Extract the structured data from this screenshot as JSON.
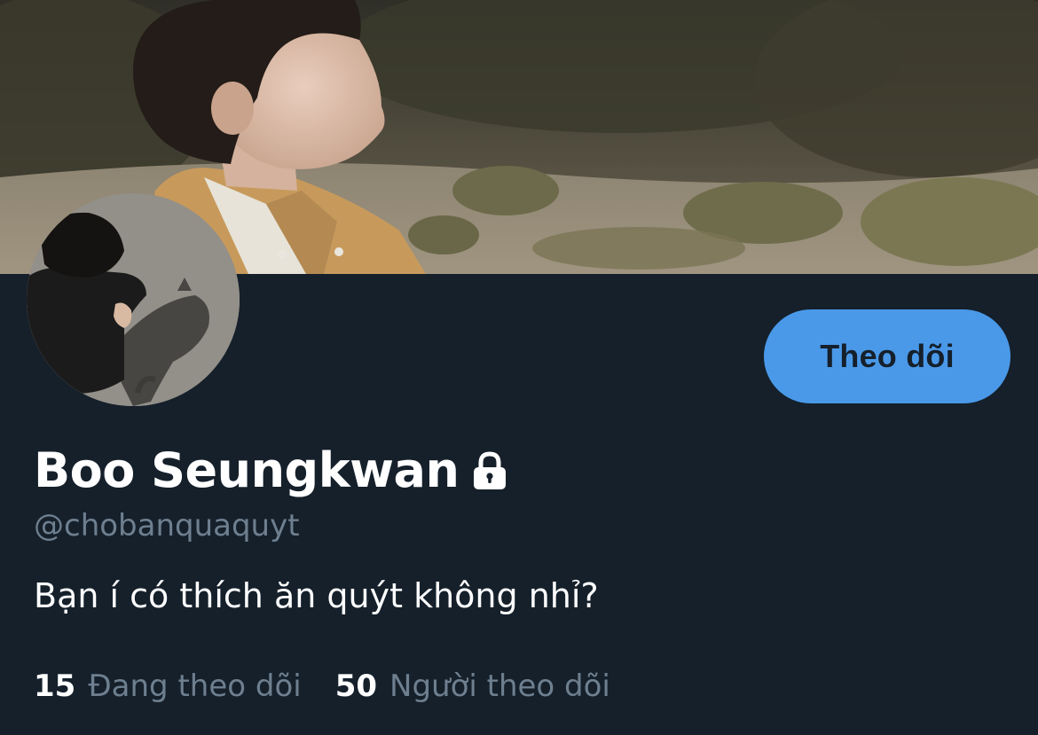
{
  "profile": {
    "banner_image": "banner-photo",
    "avatar_image": "avatar-photo",
    "display_name": "Boo Seungkwan",
    "protected_icon": "lock-icon",
    "handle": "@chobanquaquyt",
    "bio": "Bạn í có thích ăn quýt không nhỉ?"
  },
  "actions": {
    "follow_label": "Theo dõi"
  },
  "stats": {
    "following_count": "15",
    "following_label": "Đang theo dõi",
    "followers_count": "50",
    "followers_label": "Người theo dõi"
  },
  "colors": {
    "background": "#15202b",
    "accent": "#4a99e9",
    "secondary_text": "#6e7f8f",
    "primary_text": "#ffffff"
  }
}
